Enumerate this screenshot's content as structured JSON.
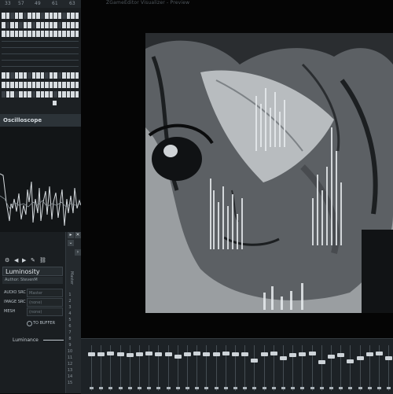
{
  "pianoroll": {
    "ruler_numbers": [
      "33",
      "57",
      "49",
      "61",
      "63"
    ]
  },
  "oscilloscope": {
    "title": "Oscilloscope"
  },
  "plugin": {
    "preset_name": "Luminosity",
    "author": "Author: StevenM",
    "rows": [
      {
        "label": "AUDIO SRC",
        "value": "Master"
      },
      {
        "label": "IMAGE SRC",
        "value": "(none)"
      },
      {
        "label": "MESH",
        "value": "(none)"
      }
    ],
    "to_buffer": "TO BUFFER",
    "param_label": "Luminance"
  },
  "strip": {
    "label": "Master",
    "numbers": [
      "1",
      "2",
      "3",
      "4",
      "5",
      "6",
      "7",
      "8",
      "9",
      "10",
      "11",
      "12",
      "13",
      "14",
      "15"
    ]
  },
  "visualizer": {
    "title": "ZGameEditor Visualizer - Preview"
  },
  "mixer": {
    "channel_levels": [
      0.18,
      0.18,
      0.16,
      0.18,
      0.2,
      0.18,
      0.16,
      0.18,
      0.18,
      0.24,
      0.18,
      0.16,
      0.18,
      0.18,
      0.16,
      0.18,
      0.18,
      0.35,
      0.18,
      0.16,
      0.3,
      0.2,
      0.18,
      0.16,
      0.4,
      0.24,
      0.2,
      0.38,
      0.3,
      0.18,
      0.16,
      0.3
    ]
  }
}
